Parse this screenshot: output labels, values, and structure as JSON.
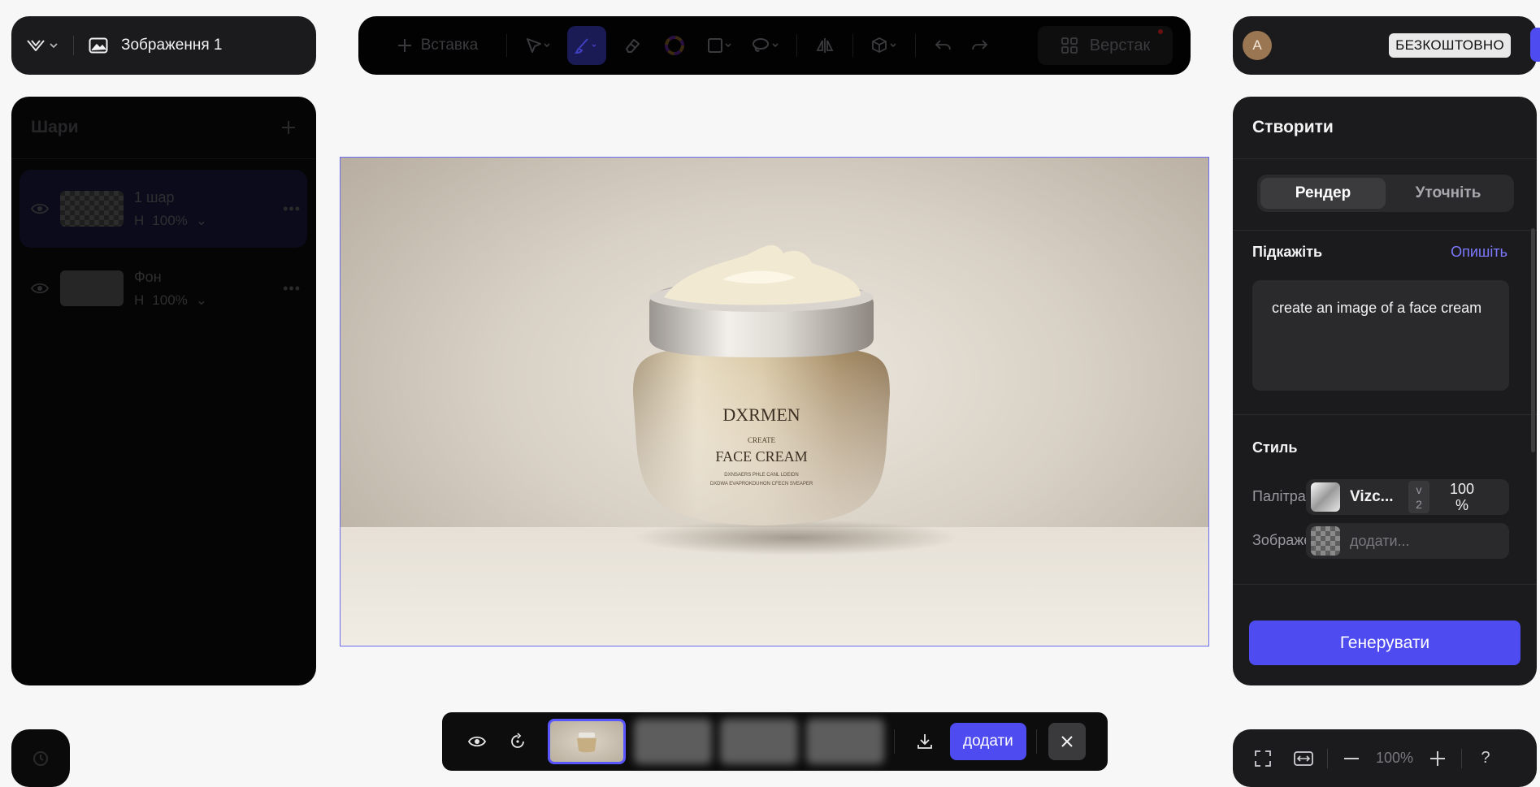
{
  "header": {
    "document_title": "Зображення 1"
  },
  "toolbar": {
    "insert_label": "Вставка",
    "layout_label": "Верстак"
  },
  "account": {
    "avatar_initial": "A",
    "plan_badge": "БЕЗКОШТОВНО"
  },
  "layers": {
    "title": "Шари",
    "items": [
      {
        "name": "1 шар",
        "mode": "Н",
        "opacity": "100%"
      },
      {
        "name": "Фон",
        "mode": "Н",
        "opacity": "100%"
      }
    ]
  },
  "canvas": {
    "label_brand": "DXRMEN",
    "label_small": "CREATE",
    "label_product": "FACE CREAM",
    "label_line1": "DXNSAERS PHLE CANL LDEIDN",
    "label_line2": "DXDWA EVAPROKDUHON CFECN SVEAPER"
  },
  "create_panel": {
    "title": "Створити",
    "tabs": [
      {
        "label": "Рендер",
        "active": true
      },
      {
        "label": "Уточніть",
        "active": false
      }
    ],
    "prompt": {
      "label": "Підкажіть",
      "action": "Опишіть",
      "text": "create an image of a face cream"
    },
    "style": {
      "title": "Стиль",
      "palette_label": "Палітра",
      "palette_name": "Vizc...",
      "palette_version_v": "v",
      "palette_version_n": "2",
      "palette_pct_value": "100",
      "palette_pct_unit": "%",
      "image_label": "Зображення",
      "image_placeholder": "додати..."
    },
    "generate_label": "Генерувати"
  },
  "gen_bar": {
    "add_label": "додати"
  },
  "zoom": {
    "value": "100%"
  },
  "colors": {
    "accent": "#4e4bf0",
    "panel": "#1b1b1d",
    "link": "#7d79ff"
  },
  "icons": [
    "logo-chevron",
    "image-icon",
    "plus-icon",
    "select-arrow-icon",
    "brush-icon",
    "eraser-icon",
    "color-wheel-icon",
    "rectangle-icon",
    "lasso-icon",
    "mirror-icon",
    "cube-icon",
    "undo-icon",
    "redo-icon",
    "grid-icon",
    "eye-icon",
    "history-icon",
    "refresh-icon",
    "download-icon",
    "close-icon",
    "fullscreen-icon",
    "fit-width-icon",
    "minus-icon",
    "help-icon"
  ]
}
